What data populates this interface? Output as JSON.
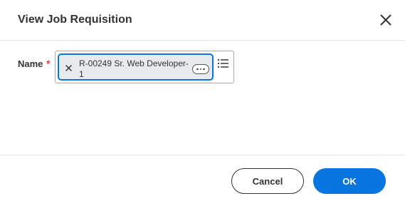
{
  "dialog": {
    "title": "View Job Requisition",
    "close_icon": "close-icon"
  },
  "form": {
    "name_field": {
      "label": "Name",
      "required_marker": "*",
      "selected_item": "R-00249 Sr. Web Developer-1",
      "remove_icon": "close-icon",
      "more_icon": "ellipsis-icon",
      "prompt_icon": "list-icon"
    }
  },
  "footer": {
    "cancel_label": "Cancel",
    "ok_label": "OK"
  },
  "colors": {
    "primary": "#0875e1",
    "required": "#de4446",
    "pill_background": "#e8ebee"
  }
}
